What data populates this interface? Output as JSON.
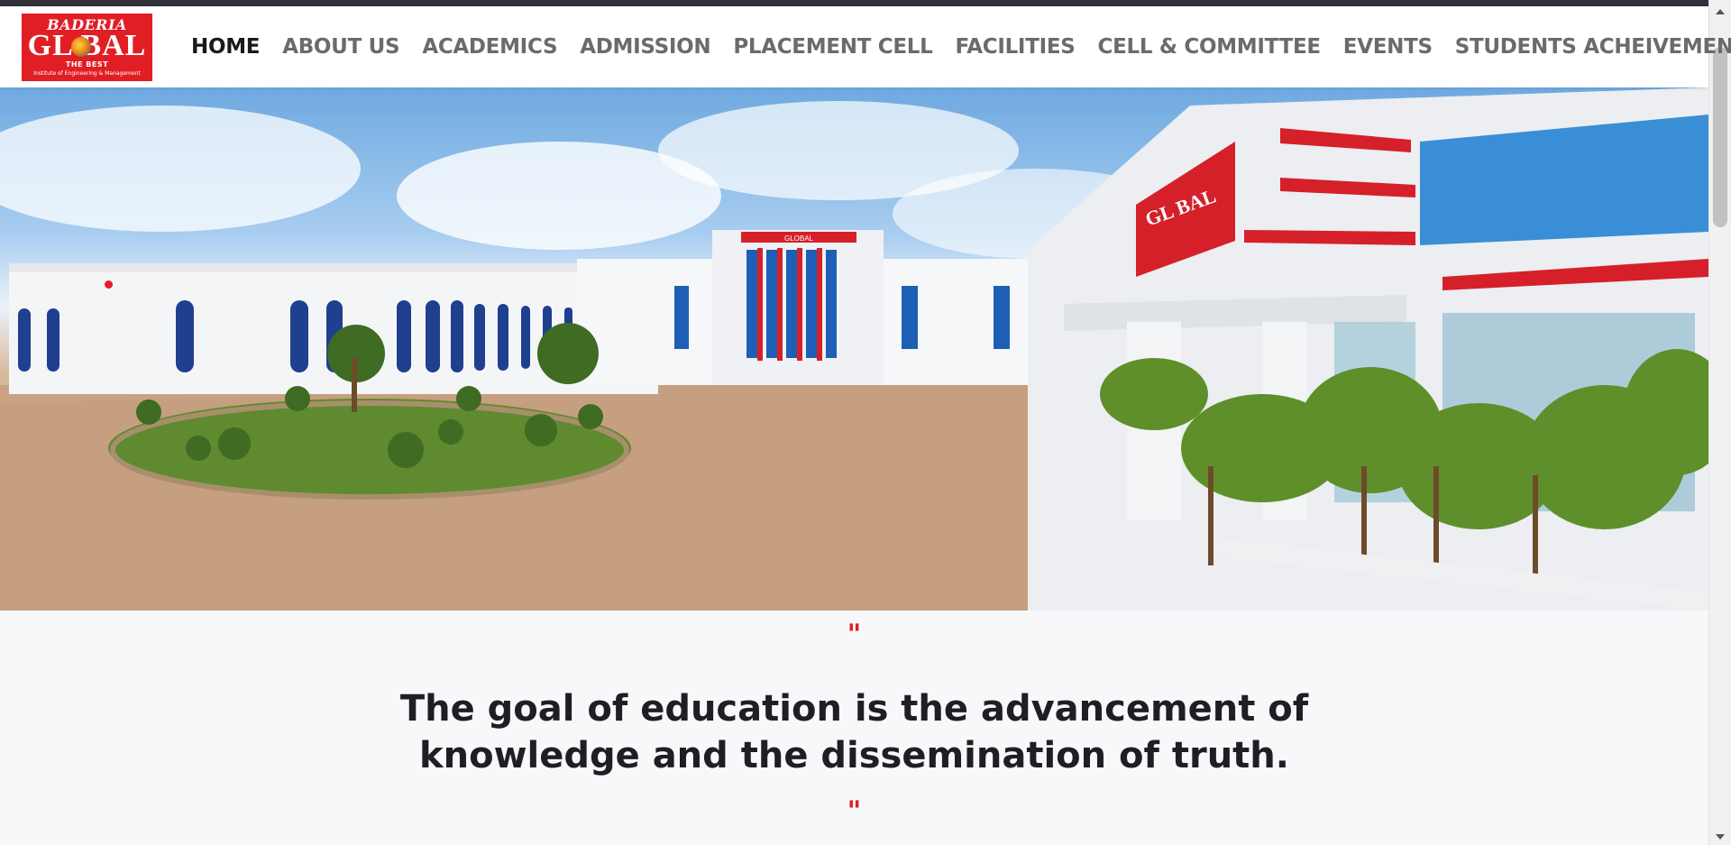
{
  "logo": {
    "line1": "BADERIA",
    "line2": "GL   BAL",
    "line3": "THE BEST",
    "line4": "Institute of Engineering & Management"
  },
  "nav": {
    "items": [
      {
        "label": "HOME",
        "active": true
      },
      {
        "label": "ABOUT US"
      },
      {
        "label": "ACADEMICS"
      },
      {
        "label": "ADMISSION"
      },
      {
        "label": "PLACEMENT CELL"
      },
      {
        "label": "FACILITIES"
      },
      {
        "label": "CELL & COMMITTEE"
      },
      {
        "label": "EVENTS"
      },
      {
        "label": "STUDENTS ACHEIVEMENTS"
      }
    ]
  },
  "hero": {
    "sign_main": "GLOBAL",
    "sign_side": "GL BAL"
  },
  "quote": {
    "open_mark": "\"",
    "text": "The goal of education is the advancement of knowledge and the dissemination of truth.",
    "close_mark": "\""
  },
  "colors": {
    "brand_red": "#e21e25",
    "nav_text": "#6b6b6b",
    "nav_active": "#1a1a1a",
    "quote_text": "#1f1f23"
  }
}
